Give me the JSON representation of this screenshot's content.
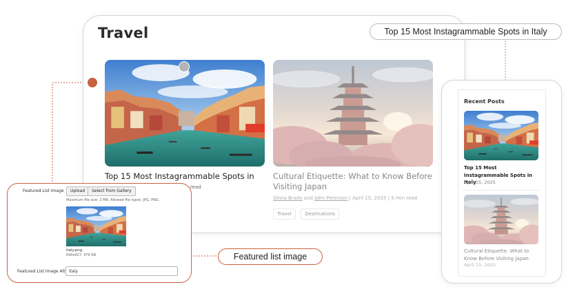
{
  "travel": {
    "heading": "Travel",
    "cards": [
      {
        "title": "Top 15 Most Instagrammable Spots in Italy",
        "meta_tail": "read"
      },
      {
        "title": "Cultural Etiquette: What to Know Before Visiting Japan",
        "author1": "Olivia Brady",
        "and": "and",
        "author2": "John Peterson",
        "date_read": "|  April 15, 2025  |  5 min read",
        "tags": [
          "Travel",
          "Destinations"
        ]
      }
    ]
  },
  "callouts": {
    "top": "Top 15 Most Instagrammable Spots in Italy",
    "bottom": "Featured list image"
  },
  "recent_posts": {
    "heading": "Recent Posts",
    "items": [
      {
        "title": "Top 15 Most Instagrammable Spots in Italy",
        "date": "April 15, 2025"
      },
      {
        "title": "Cultural Etiquette: What to Know Before Visiting Japan",
        "date": "April 15, 2025"
      }
    ]
  },
  "form": {
    "featured_label": "Featured List Image",
    "upload_button": "Upload",
    "gallery_button": "Select from Gallery",
    "hint": "Maximum file size: 2 MB. Allowed file types: JPG, PNG.",
    "file_name": "italy.png",
    "file_info": "640x427, 478 KB",
    "alt_label": "Featured List Image Alt",
    "alt_value": "italy"
  },
  "colors": {
    "accent": "#c9623f",
    "border": "#d4d4d4"
  }
}
